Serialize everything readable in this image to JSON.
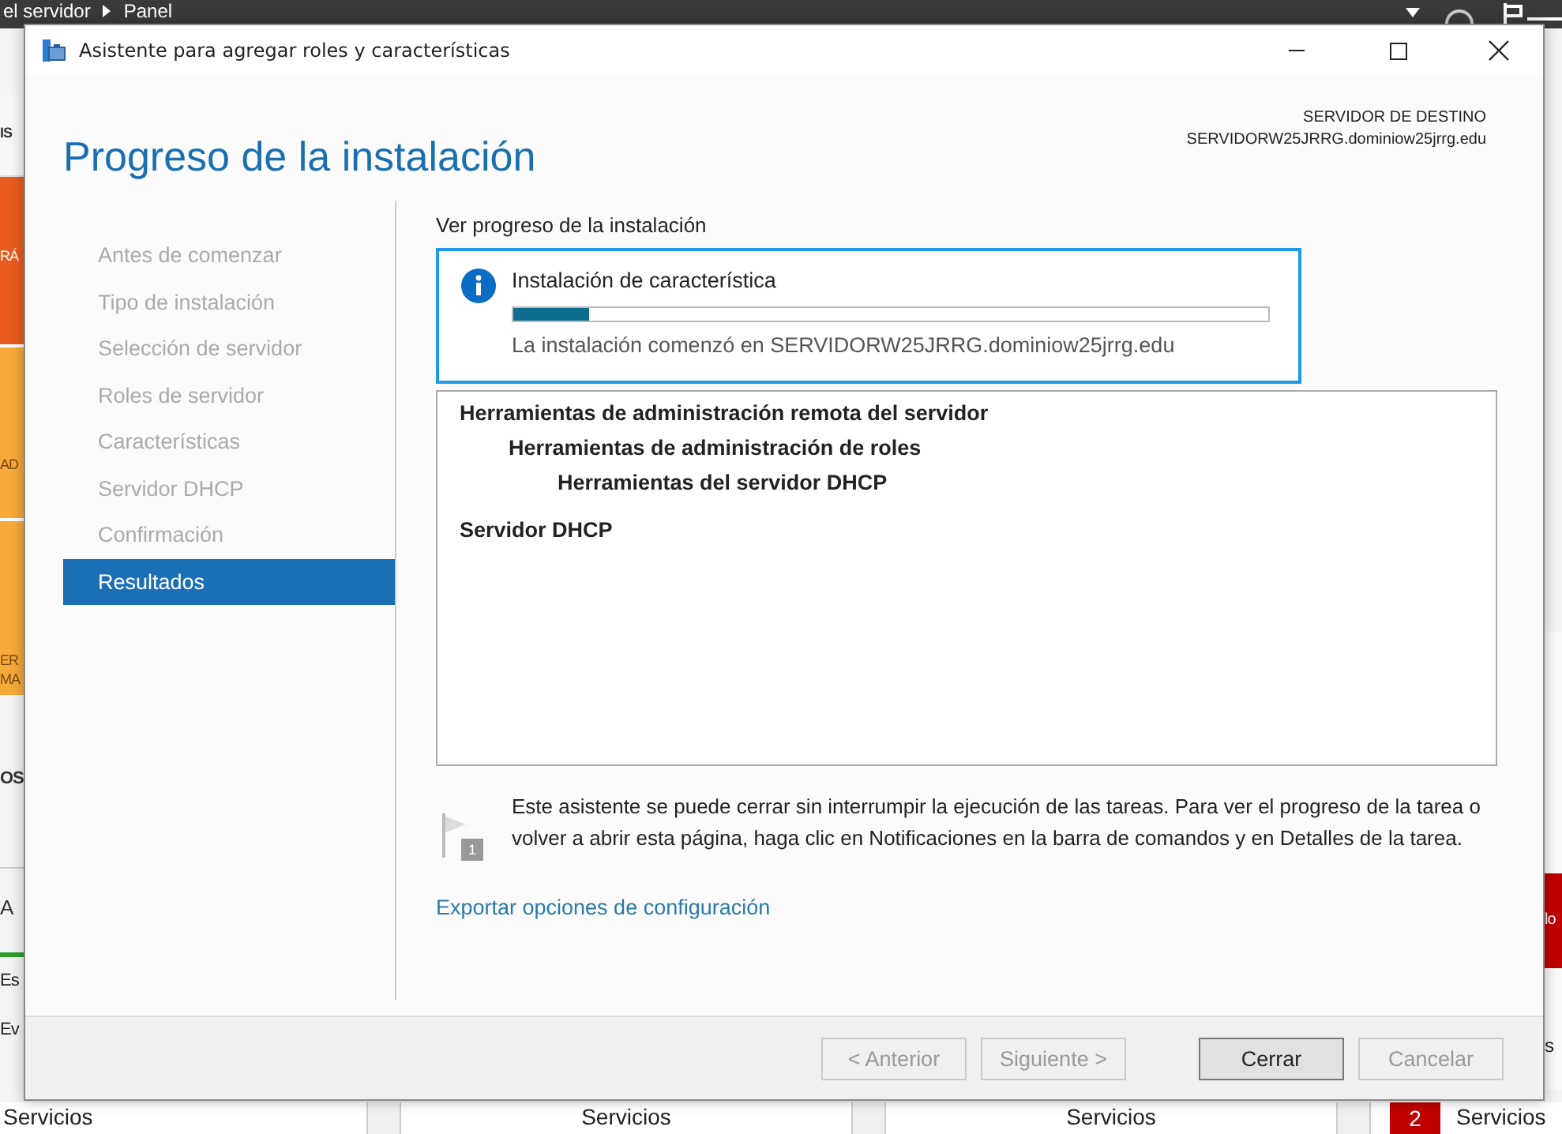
{
  "background": {
    "breadcrumb": [
      "el servidor",
      "Panel"
    ],
    "left_tiles": [
      {
        "text": "IS",
        "kind": "plain"
      },
      {
        "text": "RÁ",
        "kind": "red"
      },
      {
        "text": "AD",
        "kind": "orange"
      },
      {
        "text": "ER\nMA",
        "kind": "orange"
      },
      {
        "text": "OS",
        "kind": "plain"
      },
      {
        "text": "A",
        "kind": "plain"
      }
    ],
    "left_rows": [
      "Es",
      "Ev",
      "Servicios"
    ],
    "bottom_rows": [
      "Servicios",
      "Servicios"
    ],
    "right_tile": "lo",
    "right_row": "s",
    "right_badge": "2",
    "right_bottom": "Servicios"
  },
  "window": {
    "title": "Asistente para agregar roles y características"
  },
  "page_title": "Progreso de la instalación",
  "destination": {
    "label": "SERVIDOR DE DESTINO",
    "server": "SERVIDORW25JRRG.dominiow25jrrg.edu"
  },
  "steps": [
    {
      "label": "Antes de comenzar",
      "selected": false
    },
    {
      "label": "Tipo de instalación",
      "selected": false
    },
    {
      "label": "Selección de servidor",
      "selected": false
    },
    {
      "label": "Roles de servidor",
      "selected": false
    },
    {
      "label": "Características",
      "selected": false
    },
    {
      "label": "Servidor DHCP",
      "selected": false
    },
    {
      "label": "Confirmación",
      "selected": false
    },
    {
      "label": "Resultados",
      "selected": true
    }
  ],
  "section_label": "Ver progreso de la instalación",
  "status": {
    "title": "Instalación de característica",
    "level": 0.1,
    "message": "La instalación comenzó en SERVIDORW25JRRG.dominiow25jrrg.edu"
  },
  "results": [
    {
      "label": "Herramientas de administración remota del servidor",
      "children": [
        {
          "label": "Herramientas de administración de roles",
          "children": [
            {
              "label": "Herramientas del servidor DHCP"
            }
          ]
        }
      ]
    },
    {
      "label": "Servidor DHCP"
    }
  ],
  "note": {
    "badge": "1",
    "text": "Este asistente se puede cerrar sin interrumpir la ejecución de las tareas. Para ver el progreso de la tarea o volver a abrir esta página, haga clic en Notificaciones en la barra de comandos y en Detalles de la tarea."
  },
  "export_link": "Exportar opciones de configuración",
  "buttons": [
    {
      "label": "< Anterior",
      "disabled": true
    },
    {
      "label": "Siguiente >",
      "disabled": true
    },
    {
      "label": "Cerrar",
      "disabled": false
    },
    {
      "label": "Cancelar",
      "disabled": true
    }
  ]
}
